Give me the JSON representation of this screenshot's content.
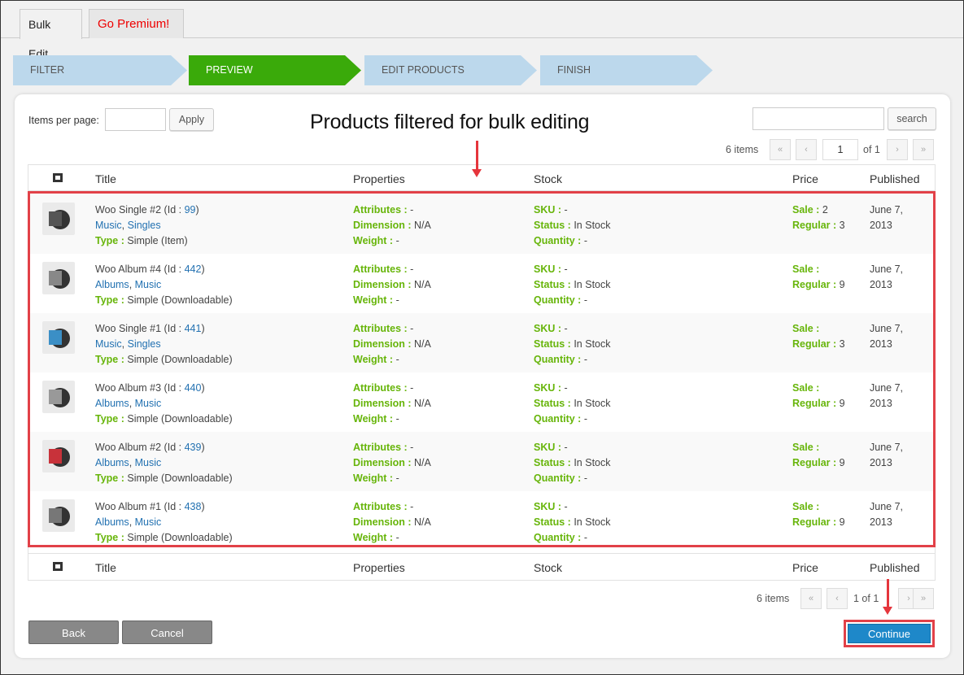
{
  "tabs": [
    {
      "label": "Bulk Edit"
    },
    {
      "label": "Go Premium!"
    }
  ],
  "steps": [
    "FILTER",
    "PREVIEW",
    "EDIT PRODUCTS",
    "FINISH"
  ],
  "toolbar": {
    "items_per_page_label": "Items per page:",
    "items_per_page_value": "",
    "apply_label": "Apply",
    "search_value": "",
    "search_label": "search",
    "headline": "Products filtered for bulk editing"
  },
  "pagination_top": {
    "count": "6 items",
    "first": "«",
    "prev": "‹",
    "page": "1",
    "of": "of 1",
    "next": "›",
    "last": "»"
  },
  "pagination_bottom": {
    "count": "6 items",
    "first": "«",
    "prev": "‹",
    "text": "1 of 1",
    "next": "›",
    "last": "»"
  },
  "columns": {
    "title": "Title",
    "properties": "Properties",
    "stock": "Stock",
    "price": "Price",
    "published": "Published"
  },
  "labels": {
    "id": "Id :",
    "type": "Type :",
    "attributes": "Attributes :",
    "dimension": "Dimension :",
    "weight": "Weight :",
    "sku": "SKU :",
    "status": "Status :",
    "quantity": "Quantity :",
    "sale": "Sale :",
    "regular": "Regular :"
  },
  "products": [
    {
      "name": "Woo Single #2",
      "id": "99",
      "cats": [
        "Music",
        "Singles"
      ],
      "type": "Simple (Item)",
      "attributes": "-",
      "dimension": "N/A",
      "weight": "-",
      "sku": "-",
      "status": "In Stock",
      "quantity": "-",
      "sale": "2",
      "regular": "3",
      "published": [
        "June 7,",
        "2013"
      ],
      "color": "#555"
    },
    {
      "name": "Woo Album #4",
      "id": "442",
      "cats": [
        "Albums",
        "Music"
      ],
      "type": "Simple (Downloadable)",
      "attributes": "-",
      "dimension": "N/A",
      "weight": "-",
      "sku": "-",
      "status": "In Stock",
      "quantity": "-",
      "sale": "",
      "regular": "9",
      "published": [
        "June 7,",
        "2013"
      ],
      "color": "#888"
    },
    {
      "name": "Woo Single #1",
      "id": "441",
      "cats": [
        "Music",
        "Singles"
      ],
      "type": "Simple (Downloadable)",
      "attributes": "-",
      "dimension": "N/A",
      "weight": "-",
      "sku": "-",
      "status": "In Stock",
      "quantity": "-",
      "sale": "",
      "regular": "3",
      "published": [
        "June 7,",
        "2013"
      ],
      "color": "#3b8fc6"
    },
    {
      "name": "Woo Album #3",
      "id": "440",
      "cats": [
        "Albums",
        "Music"
      ],
      "type": "Simple (Downloadable)",
      "attributes": "-",
      "dimension": "N/A",
      "weight": "-",
      "sku": "-",
      "status": "In Stock",
      "quantity": "-",
      "sale": "",
      "regular": "9",
      "published": [
        "June 7,",
        "2013"
      ],
      "color": "#999"
    },
    {
      "name": "Woo Album #2",
      "id": "439",
      "cats": [
        "Albums",
        "Music"
      ],
      "type": "Simple (Downloadable)",
      "attributes": "-",
      "dimension": "N/A",
      "weight": "-",
      "sku": "-",
      "status": "In Stock",
      "quantity": "-",
      "sale": "",
      "regular": "9",
      "published": [
        "June 7,",
        "2013"
      ],
      "color": "#c8323a"
    },
    {
      "name": "Woo Album #1",
      "id": "438",
      "cats": [
        "Albums",
        "Music"
      ],
      "type": "Simple (Downloadable)",
      "attributes": "-",
      "dimension": "N/A",
      "weight": "-",
      "sku": "-",
      "status": "In Stock",
      "quantity": "-",
      "sale": "",
      "regular": "9",
      "published": [
        "June 7,",
        "2013"
      ],
      "color": "#777"
    }
  ],
  "footer": {
    "back": "Back",
    "cancel": "Cancel",
    "continue": "Continue"
  },
  "colors": {
    "step_active": "#3aaa0a",
    "step_inactive": "#bcd8ec",
    "label_green": "#67b50a",
    "link": "#2271b1",
    "highlight_red": "#e24148",
    "continue_blue": "#1e88c9"
  }
}
